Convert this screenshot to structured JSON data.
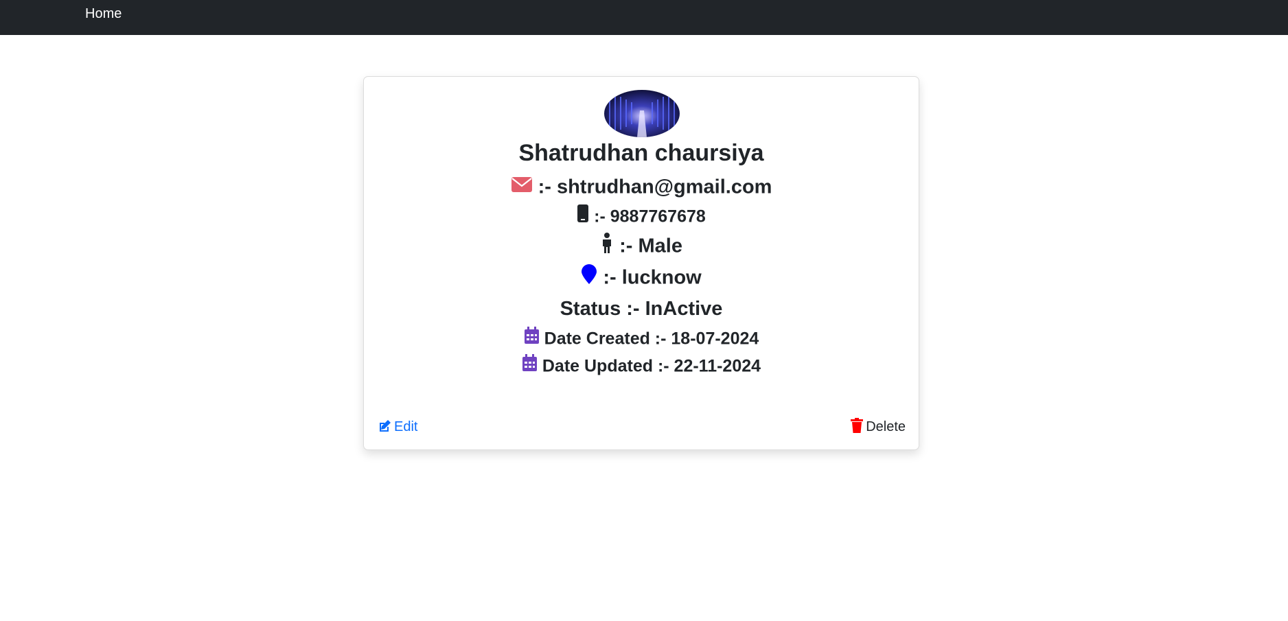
{
  "nav": {
    "home_label": "Home"
  },
  "profile": {
    "name": "Shatrudhan chaursiya",
    "email_text": ":- shtrudhan@gmail.com",
    "phone_text": ":- 9887767678",
    "gender_text": ":- Male",
    "location_text": ":- lucknow",
    "status_text": "Status :- InActive",
    "date_created_text": "Date Created :- 18-07-2024",
    "date_updated_text": "Date Updated :- 22-11-2024"
  },
  "actions": {
    "edit_label": "Edit",
    "delete_label": "Delete"
  },
  "icons": {
    "email": "envelope-icon",
    "phone": "mobile-phone-icon",
    "gender": "person-icon",
    "location": "map-pin-icon",
    "calendar": "calendar-icon",
    "edit": "edit-icon",
    "delete": "trash-icon"
  },
  "colors": {
    "navbar": "#212529",
    "envelope": "#e35d6a",
    "location": "#0000ff",
    "calendar": "#6f42c1",
    "edit": "#0d6efd",
    "delete": "#ff0000"
  }
}
